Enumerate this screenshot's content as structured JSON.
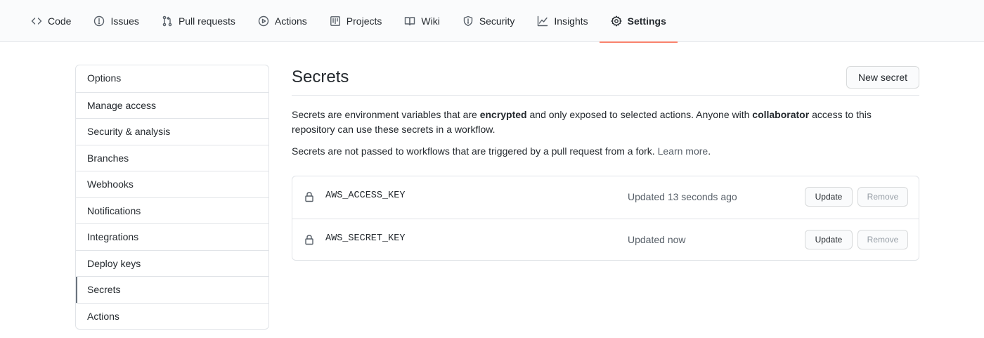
{
  "nav": {
    "tabs": [
      {
        "label": "Code",
        "icon": "code-icon",
        "selected": false
      },
      {
        "label": "Issues",
        "icon": "issue-icon",
        "selected": false
      },
      {
        "label": "Pull requests",
        "icon": "pull-request-icon",
        "selected": false
      },
      {
        "label": "Actions",
        "icon": "play-icon",
        "selected": false
      },
      {
        "label": "Projects",
        "icon": "project-icon",
        "selected": false
      },
      {
        "label": "Wiki",
        "icon": "book-icon",
        "selected": false
      },
      {
        "label": "Security",
        "icon": "shield-icon",
        "selected": false
      },
      {
        "label": "Insights",
        "icon": "graph-icon",
        "selected": false
      },
      {
        "label": "Settings",
        "icon": "gear-icon",
        "selected": true
      }
    ],
    "selected_underline_color": "#f9826c"
  },
  "sidebar": {
    "items": [
      {
        "label": "Options"
      },
      {
        "label": "Manage access"
      },
      {
        "label": "Security & analysis"
      },
      {
        "label": "Branches"
      },
      {
        "label": "Webhooks"
      },
      {
        "label": "Notifications"
      },
      {
        "label": "Integrations"
      },
      {
        "label": "Deploy keys"
      },
      {
        "label": "Secrets",
        "active": true
      },
      {
        "label": "Actions"
      }
    ]
  },
  "main": {
    "title": "Secrets",
    "new_secret_label": "New secret",
    "description": {
      "p1_a": "Secrets are environment variables that are ",
      "p1_b": "encrypted",
      "p1_c": " and only exposed to selected actions. Anyone with ",
      "p1_d": "collaborator",
      "p1_e": " access to this repository can use these secrets in a workflow.",
      "p2_a": "Secrets are not passed to workflows that are triggered by a pull request from a fork. ",
      "p2_link": "Learn more",
      "p2_end": "."
    },
    "secrets": [
      {
        "name": "AWS_ACCESS_KEY",
        "updated": "Updated 13 seconds ago",
        "update_label": "Update",
        "remove_label": "Remove",
        "icon": "lock-icon"
      },
      {
        "name": "AWS_SECRET_KEY",
        "updated": "Updated now",
        "update_label": "Update",
        "remove_label": "Remove",
        "icon": "lock-icon"
      }
    ]
  }
}
